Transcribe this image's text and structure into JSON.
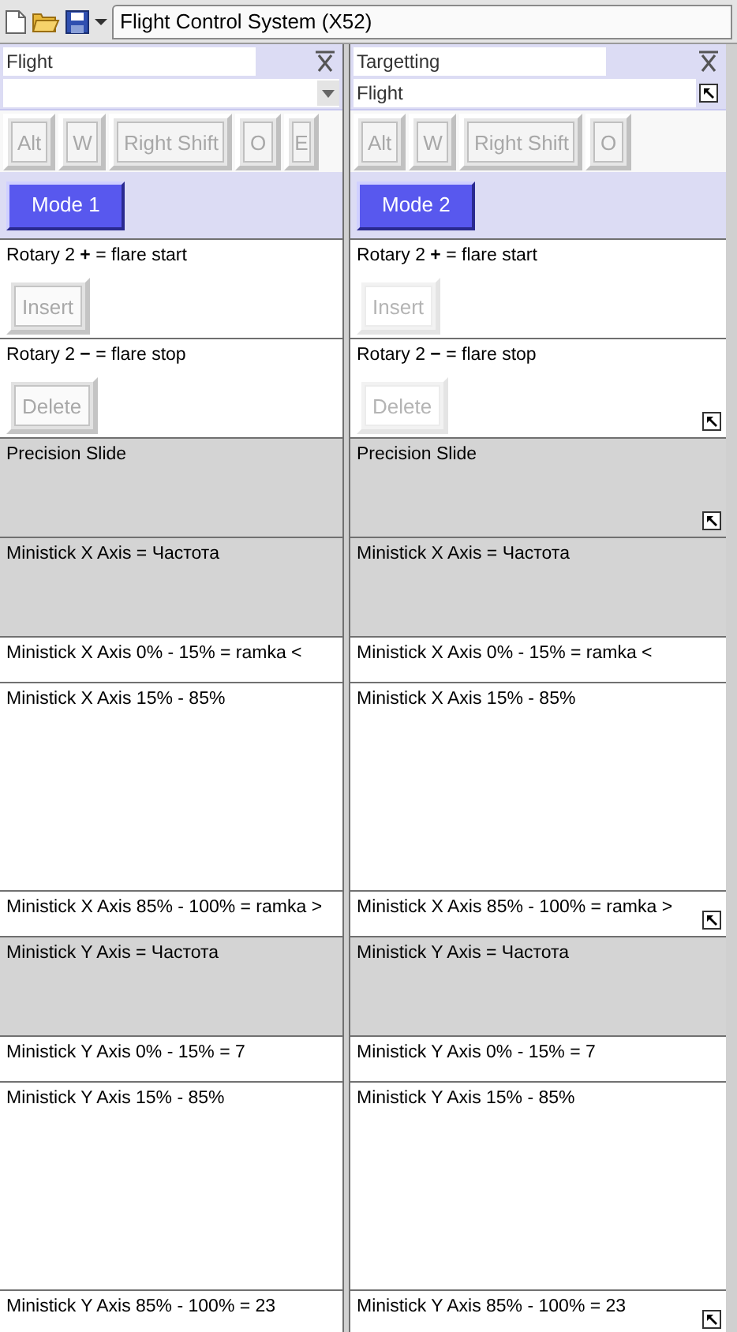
{
  "toolbar": {
    "title": "Flight Control System (X52)"
  },
  "panels": [
    {
      "title": "Flight",
      "selector": {
        "kind": "dropdown"
      },
      "keys": [
        {
          "label": "Alt"
        },
        {
          "label": "W"
        },
        {
          "label": "Right Shift"
        },
        {
          "label": "O"
        },
        {
          "label": "E"
        }
      ],
      "mode_button": "Mode 1",
      "rows": [
        {
          "kind": "action",
          "text": "Rotary 2 **+** = flare start",
          "button": {
            "label": "Insert",
            "disabled": false
          },
          "resize_handle": false
        },
        {
          "kind": "action",
          "text": "Rotary 2 **−** = flare stop",
          "button": {
            "label": "Delete",
            "disabled": false
          },
          "resize_handle": false
        },
        {
          "kind": "group",
          "text": "Precision Slide",
          "resize_handle": false
        },
        {
          "kind": "group",
          "text": "Ministick X Axis = Частота",
          "resize_handle": false
        },
        {
          "kind": "edge",
          "text": "Ministick X Axis 0% - 15% = ramka <",
          "resize_handle": false
        },
        {
          "kind": "range",
          "text": "Ministick X Axis 15% - 85%",
          "resize_handle": false
        },
        {
          "kind": "edge",
          "text": "Ministick X Axis 85% - 100% = ramka >",
          "resize_handle": false
        },
        {
          "kind": "group",
          "text": "Ministick Y Axis = Частота",
          "resize_handle": false
        },
        {
          "kind": "edge",
          "text": "Ministick Y Axis 0% - 15% = 7",
          "resize_handle": false
        },
        {
          "kind": "range",
          "text": "Ministick Y Axis 15% - 85%",
          "resize_handle": false
        },
        {
          "kind": "edge",
          "text": "Ministick Y Axis 85% - 100% = 23",
          "resize_handle": false
        }
      ]
    },
    {
      "title": "Targetting",
      "selector": {
        "kind": "field",
        "value": "Flight"
      },
      "keys": [
        {
          "label": "Alt"
        },
        {
          "label": "W"
        },
        {
          "label": "Right Shift"
        },
        {
          "label": "O"
        }
      ],
      "mode_button": "Mode 2",
      "rows": [
        {
          "kind": "action",
          "text": "Rotary 2 **+** = flare start",
          "button": {
            "label": "Insert",
            "disabled": true
          },
          "resize_handle": false
        },
        {
          "kind": "action",
          "text": "Rotary 2 **−** = flare stop",
          "button": {
            "label": "Delete",
            "disabled": true
          },
          "resize_handle": true
        },
        {
          "kind": "group",
          "text": "Precision Slide",
          "resize_handle": true
        },
        {
          "kind": "group",
          "text": "Ministick X Axis = Частота",
          "resize_handle": false
        },
        {
          "kind": "edge",
          "text": "Ministick X Axis 0% - 15% = ramka <",
          "resize_handle": false
        },
        {
          "kind": "range",
          "text": "Ministick X Axis 15% - 85%",
          "resize_handle": false
        },
        {
          "kind": "edge",
          "text": "Ministick X Axis 85% - 100% = ramka >",
          "resize_handle": true
        },
        {
          "kind": "group",
          "text": "Ministick Y Axis = Частота",
          "resize_handle": false
        },
        {
          "kind": "edge",
          "text": "Ministick Y Axis 0% - 15% = 7",
          "resize_handle": false
        },
        {
          "kind": "range",
          "text": "Ministick Y Axis 15% - 85%",
          "resize_handle": false
        },
        {
          "kind": "edge",
          "text": "Ministick Y Axis 85% - 100% = 23",
          "resize_handle": true
        }
      ]
    }
  ]
}
